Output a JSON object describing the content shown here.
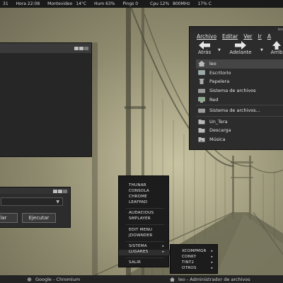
{
  "topbar": {
    "day": "31",
    "time": "Hora 22:08",
    "weather_city": "Montevideo",
    "temperature": "14°C",
    "humidity": "Hum 63%",
    "pings": "Pings 0",
    "cpu": "Cpu 12%",
    "freq": "800MHz",
    "extra": "17% C"
  },
  "run_dialog": {
    "cancel_label": "lar",
    "run_label": "Ejecutar"
  },
  "file_manager": {
    "title_fragment": "leo",
    "menu": [
      "Archivo",
      "Editar",
      "Ver",
      "Ir",
      "A"
    ],
    "toolbar": {
      "back_label": "Atrás",
      "forward_label": "Adelante",
      "up_label": "Arrib"
    },
    "places": [
      {
        "label": "leo",
        "icon": "home-icon",
        "selected": true
      },
      {
        "label": "Escritorio",
        "icon": "desktop-icon",
        "selected": false
      },
      {
        "label": "Papelera",
        "icon": "trash-icon",
        "selected": false
      },
      {
        "label": "Sistema de archivos",
        "icon": "drive-icon",
        "selected": false
      },
      {
        "label": "Red",
        "icon": "network-icon",
        "selected": false
      },
      {
        "label": "Sistema de archivos...",
        "icon": "drive-icon",
        "selected": false
      },
      {
        "label": "Un_Tera",
        "icon": "folder-icon",
        "selected": false
      },
      {
        "label": "Descarga",
        "icon": "folder-icon",
        "selected": false
      },
      {
        "label": "Música",
        "icon": "music-folder-icon",
        "selected": false
      }
    ]
  },
  "start_menu": {
    "items": [
      "THUNAR",
      "CONSOLA",
      "CHROME",
      "LEAFPAD",
      "AUDACIOUS",
      "SMPLAYER",
      "EDIT MENU",
      "JDOWNDER",
      "SISTEMA",
      "LUGARES",
      "SALIR"
    ],
    "submenu_items": [
      "XCOMPMGR",
      "CONKY",
      "TINT2",
      "OTROS"
    ]
  },
  "taskbar": {
    "task1": "Google - Chromium",
    "task2": "leo - Administrador de archivos"
  },
  "colors": {
    "panel_bg": "#1a1a1a",
    "window_bg": "#2c2c2c",
    "selection": "#454545",
    "wallpaper_fog": "#c8c4a2"
  }
}
